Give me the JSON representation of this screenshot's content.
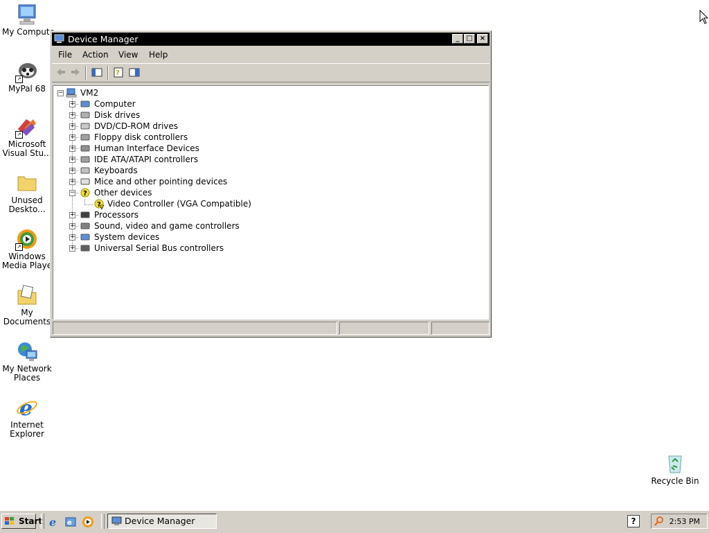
{
  "desktop": {
    "icons": [
      {
        "label": "My Computer",
        "icon": "my-computer-icon"
      },
      {
        "label": "MyPal 68",
        "icon": "mypal-icon"
      },
      {
        "label_line1": "Microsoft",
        "label_line2": "Visual Stu...",
        "icon": "visual-studio-icon"
      },
      {
        "label_line1": "Unused",
        "label_line2": "Deskto...",
        "icon": "folder-icon"
      },
      {
        "label_line1": "Windows",
        "label_line2": "Media Playe",
        "icon": "media-player-icon"
      },
      {
        "label_line1": "My",
        "label_line2": "Documents",
        "icon": "my-documents-icon"
      },
      {
        "label_line1": "My Network",
        "label_line2": "Places",
        "icon": "network-places-icon"
      },
      {
        "label_line1": "Internet",
        "label_line2": "Explorer",
        "icon": "internet-explorer-icon"
      },
      {
        "label": "Recycle Bin",
        "icon": "recycle-bin-icon"
      }
    ]
  },
  "window": {
    "title": "Device Manager",
    "controls": {
      "minimize": "_",
      "maximize": "□",
      "close": "×"
    },
    "menu": [
      "File",
      "Action",
      "View",
      "Help"
    ],
    "tree": {
      "root": "VM2",
      "categories": [
        "Computer",
        "Disk drives",
        "DVD/CD-ROM drives",
        "Floppy disk controllers",
        "Human Interface Devices",
        "IDE ATA/ATAPI controllers",
        "Keyboards",
        "Mice and other pointing devices",
        "Other devices",
        "Processors",
        "Sound, video and game controllers",
        "System devices",
        "Universal Serial Bus controllers"
      ],
      "other_devices_child": "Video Controller (VGA Compatible)"
    }
  },
  "taskbar": {
    "start_label": "Start",
    "task_label": "Device Manager",
    "help_label": "?",
    "clock": "2:53 PM"
  }
}
